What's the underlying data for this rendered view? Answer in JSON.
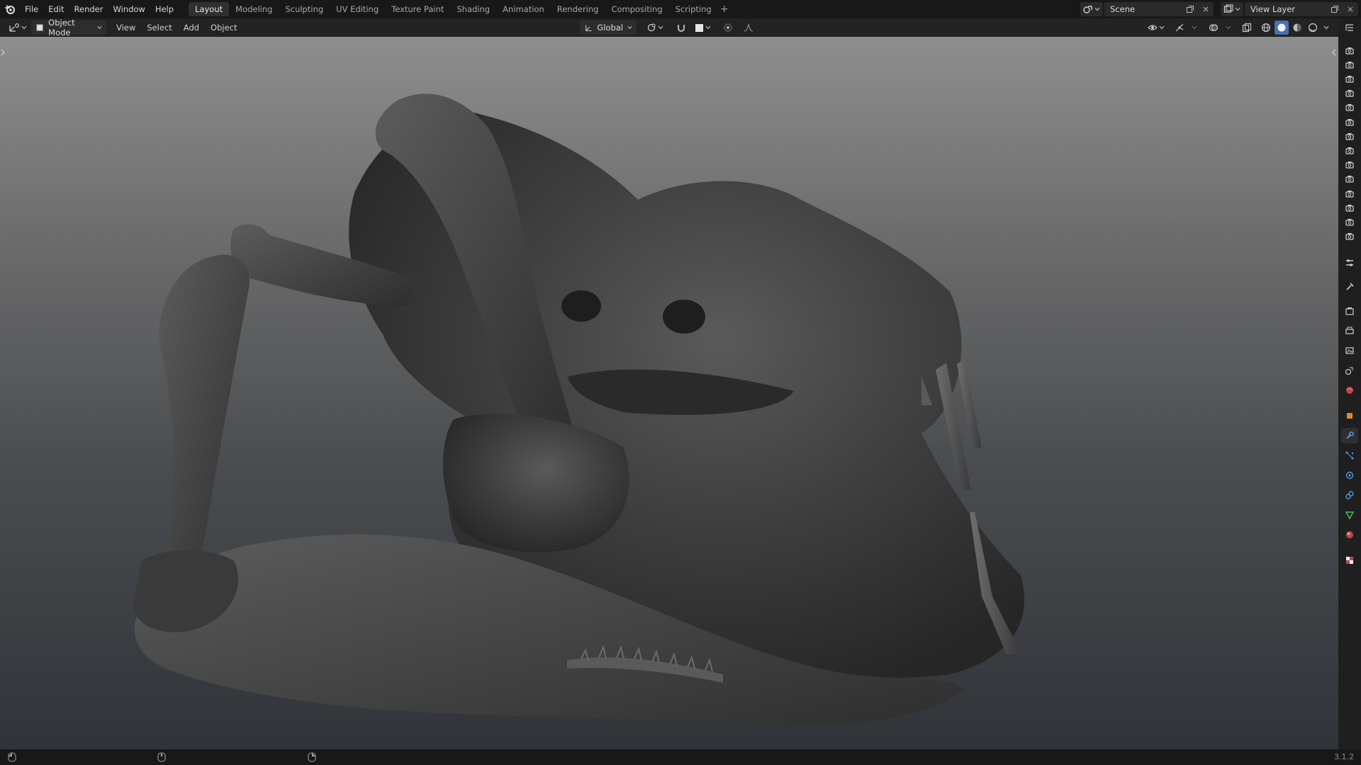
{
  "menus": [
    "File",
    "Edit",
    "Render",
    "Window",
    "Help"
  ],
  "workspaces": [
    {
      "label": "Layout",
      "active": true
    },
    {
      "label": "Modeling"
    },
    {
      "label": "Sculpting"
    },
    {
      "label": "UV Editing"
    },
    {
      "label": "Texture Paint"
    },
    {
      "label": "Shading"
    },
    {
      "label": "Animation"
    },
    {
      "label": "Rendering"
    },
    {
      "label": "Compositing"
    },
    {
      "label": "Scripting"
    }
  ],
  "scene": {
    "name": "Scene"
  },
  "view_layer": {
    "name": "View Layer"
  },
  "header": {
    "mode": "Object Mode",
    "menus": [
      "View",
      "Select",
      "Add",
      "Object"
    ],
    "orientation": "Global"
  },
  "status": {
    "version": "3.1.2"
  },
  "colors": {
    "accent": "#4772b3",
    "bg": "#1d1d1d"
  }
}
